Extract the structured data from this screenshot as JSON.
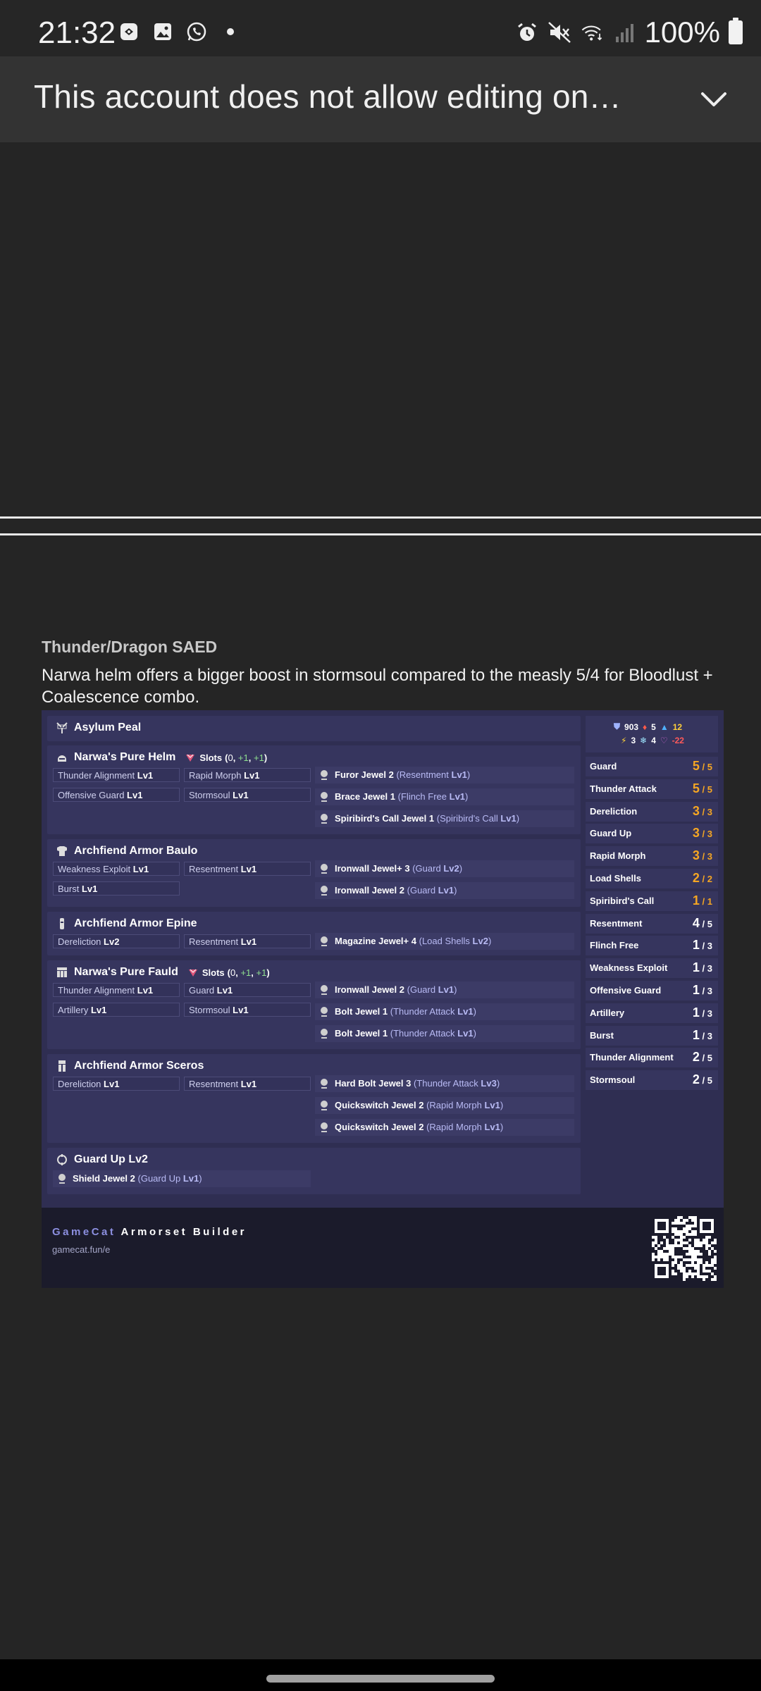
{
  "status_bar": {
    "time": "21:32",
    "battery": "100%",
    "left_icons": [
      "bixby-icon",
      "gallery-icon",
      "whatsapp-icon",
      "dot-icon"
    ],
    "right_icons": [
      "alarm-icon",
      "mute-icon",
      "wifi-icon",
      "signal-icon",
      "battery-icon"
    ]
  },
  "banner": {
    "text": "This account does not allow editing on…"
  },
  "post": {
    "title": "Thunder/Dragon SAED",
    "description": "Narwa helm offers a bigger boost in stormsoul compared to the measly 5/4 for Bloodlust + Coalescence combo."
  },
  "build": {
    "weapon": {
      "name": "Asylum Peal"
    },
    "pieces": [
      {
        "name": "Narwa's Pure Helm",
        "slots_label": "Slots",
        "slots": [
          "0",
          "+1",
          "+1"
        ],
        "skills": [
          {
            "name": "Thunder Alignment",
            "lv": "Lv1"
          },
          {
            "name": "Rapid Morph",
            "lv": "Lv1"
          },
          {
            "name": "Offensive Guard",
            "lv": "Lv1"
          },
          {
            "name": "Stormsoul",
            "lv": "Lv1"
          }
        ],
        "jewels": [
          {
            "name": "Furor Jewel 2",
            "skill": "Resentment",
            "lv": "Lv1"
          },
          {
            "name": "Brace Jewel 1",
            "skill": "Flinch Free",
            "lv": "Lv1"
          },
          {
            "name": "Spiribird's Call Jewel 1",
            "skill": "Spiribird's Call",
            "lv": "Lv1"
          }
        ]
      },
      {
        "name": "Archfiend Armor Baulo",
        "skills": [
          {
            "name": "Weakness Exploit",
            "lv": "Lv1"
          },
          {
            "name": "Resentment",
            "lv": "Lv1"
          },
          {
            "name": "Burst",
            "lv": "Lv1"
          }
        ],
        "jewels": [
          {
            "name": "Ironwall Jewel+ 3",
            "skill": "Guard",
            "lv": "Lv2"
          },
          {
            "name": "Ironwall Jewel 2",
            "skill": "Guard",
            "lv": "Lv1"
          }
        ]
      },
      {
        "name": "Archfiend Armor Epine",
        "skills": [
          {
            "name": "Dereliction",
            "lv": "Lv2"
          },
          {
            "name": "Resentment",
            "lv": "Lv1"
          }
        ],
        "jewels": [
          {
            "name": "Magazine Jewel+ 4",
            "skill": "Load Shells",
            "lv": "Lv2"
          }
        ]
      },
      {
        "name": "Narwa's Pure Fauld",
        "slots_label": "Slots",
        "slots": [
          "0",
          "+1",
          "+1"
        ],
        "skills": [
          {
            "name": "Thunder Alignment",
            "lv": "Lv1"
          },
          {
            "name": "Guard",
            "lv": "Lv1"
          },
          {
            "name": "Artillery",
            "lv": "Lv1"
          },
          {
            "name": "Stormsoul",
            "lv": "Lv1"
          }
        ],
        "jewels": [
          {
            "name": "Ironwall Jewel 2",
            "skill": "Guard",
            "lv": "Lv1"
          },
          {
            "name": "Bolt Jewel 1",
            "skill": "Thunder Attack",
            "lv": "Lv1"
          },
          {
            "name": "Bolt Jewel 1",
            "skill": "Thunder Attack",
            "lv": "Lv1"
          }
        ]
      },
      {
        "name": "Archfiend Armor Sceros",
        "skills": [
          {
            "name": "Dereliction",
            "lv": "Lv1"
          },
          {
            "name": "Resentment",
            "lv": "Lv1"
          }
        ],
        "jewels": [
          {
            "name": "Hard Bolt Jewel 3",
            "skill": "Thunder Attack",
            "lv": "Lv3"
          },
          {
            "name": "Quickswitch Jewel 2",
            "skill": "Rapid Morph",
            "lv": "Lv1"
          },
          {
            "name": "Quickswitch Jewel 2",
            "skill": "Rapid Morph",
            "lv": "Lv1"
          }
        ]
      },
      {
        "name": "Guard Up Lv2",
        "jewels": [
          {
            "name": "Shield Jewel 2",
            "skill": "Guard Up",
            "lv": "Lv1"
          }
        ]
      }
    ],
    "stats": {
      "defense": "903",
      "fire": "5",
      "water": "12",
      "thunder": "3",
      "ice": "4",
      "dragon": "-22"
    },
    "skill_totals": [
      {
        "name": "Guard",
        "lv": "5",
        "max": "5"
      },
      {
        "name": "Thunder Attack",
        "lv": "5",
        "max": "5"
      },
      {
        "name": "Dereliction",
        "lv": "3",
        "max": "3"
      },
      {
        "name": "Guard Up",
        "lv": "3",
        "max": "3"
      },
      {
        "name": "Rapid Morph",
        "lv": "3",
        "max": "3"
      },
      {
        "name": "Load Shells",
        "lv": "2",
        "max": "2"
      },
      {
        "name": "Spiribird's Call",
        "lv": "1",
        "max": "1"
      },
      {
        "name": "Resentment",
        "lv": "4",
        "max": "5"
      },
      {
        "name": "Flinch Free",
        "lv": "1",
        "max": "3"
      },
      {
        "name": "Weakness Exploit",
        "lv": "1",
        "max": "3"
      },
      {
        "name": "Offensive Guard",
        "lv": "1",
        "max": "3"
      },
      {
        "name": "Artillery",
        "lv": "1",
        "max": "3"
      },
      {
        "name": "Burst",
        "lv": "1",
        "max": "3"
      },
      {
        "name": "Thunder Alignment",
        "lv": "2",
        "max": "5"
      },
      {
        "name": "Stormsoul",
        "lv": "2",
        "max": "5"
      }
    ],
    "footer": {
      "brand_a": "GameCat",
      "brand_b": "Armorset Builder",
      "url": "gamecat.fun/e"
    }
  },
  "colors": {
    "maxed": "#f5a623",
    "partial": "#ffffff",
    "accent": "#8c8fe0"
  }
}
